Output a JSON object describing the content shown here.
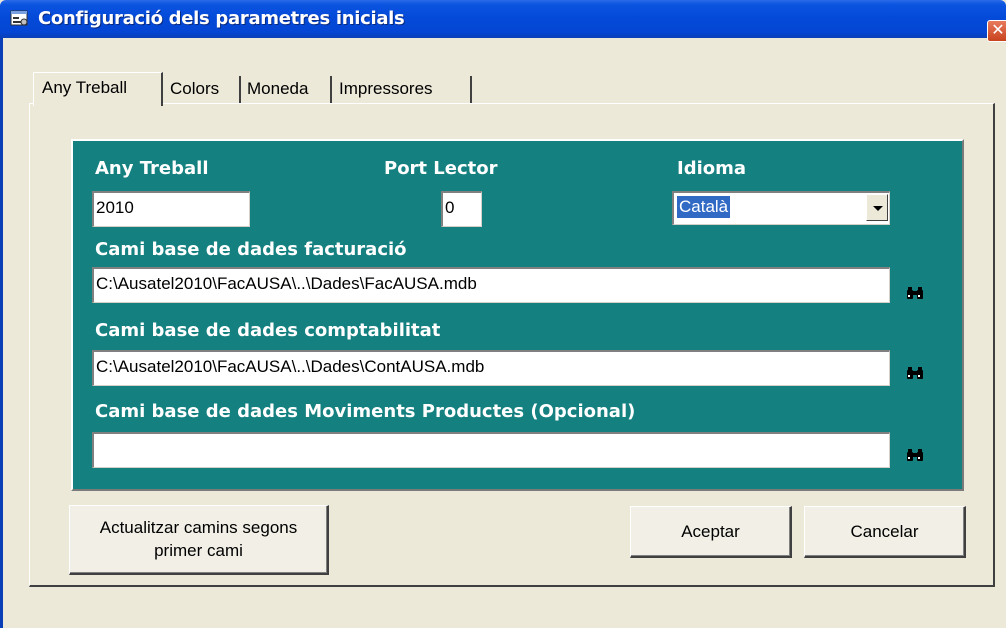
{
  "window": {
    "title": "Configuració dels parametres inicials",
    "close_symbol": "✕",
    "icon": "settings-window-icon"
  },
  "tabs": [
    {
      "label": "Any Treball",
      "active": true
    },
    {
      "label": "Colors",
      "active": false
    },
    {
      "label": "Moneda",
      "active": false
    },
    {
      "label": "Impressores",
      "active": false
    }
  ],
  "form": {
    "any_treball": {
      "label": "Any Treball",
      "value": "2010"
    },
    "port_lector": {
      "label": "Port Lector",
      "value": "0"
    },
    "idioma": {
      "label": "Idioma",
      "value": "Català"
    },
    "cami_facturacio": {
      "label": "Cami base de dades facturació",
      "value": "C:\\Ausatel2010\\FacAUSA\\..\\Dades\\FacAUSA.mdb",
      "browse_icon": "binoculars-icon"
    },
    "cami_comptabilitat": {
      "label": "Cami base de dades comptabilitat",
      "value": "C:\\Ausatel2010\\FacAUSA\\..\\Dades\\ContAUSA.mdb",
      "browse_icon": "binoculars-icon"
    },
    "cami_moviments": {
      "label": "Cami base de dades Moviments Productes (Opcional)",
      "value": "",
      "browse_icon": "binoculars-icon"
    }
  },
  "buttons": {
    "actualitzar_line1": "Actualitzar camins segons",
    "actualitzar_line2": "primer cami",
    "aceptar": "Aceptar",
    "cancelar": "Cancelar"
  },
  "colors": {
    "panel": "#148080",
    "titlebar": "#0449D8",
    "window": "#ECE9D8"
  }
}
